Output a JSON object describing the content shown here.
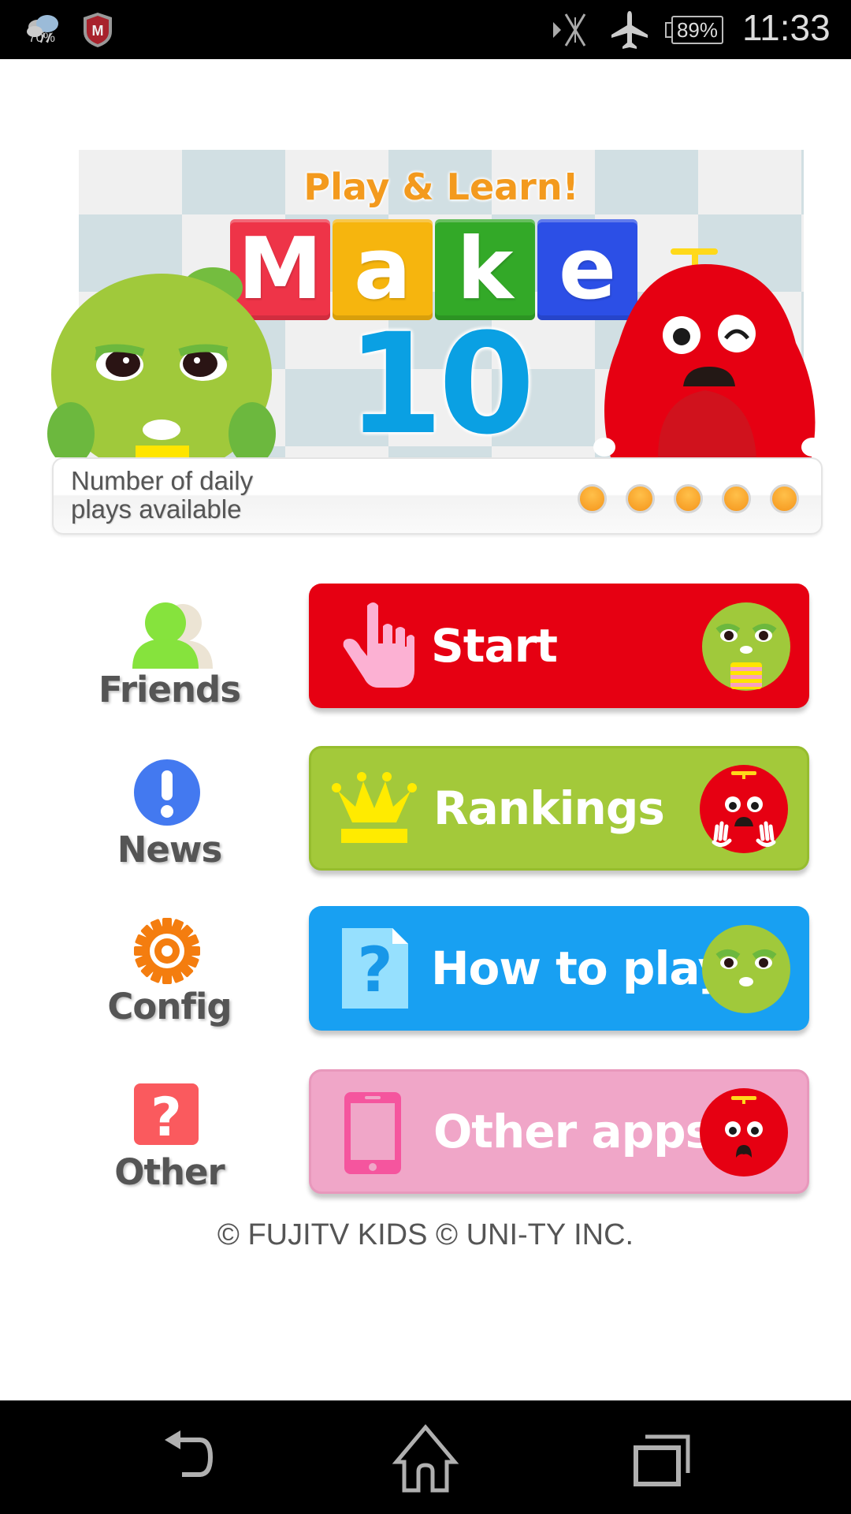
{
  "status_bar": {
    "weather_percent": "70%",
    "battery": "89%",
    "time": "11:33",
    "icons": [
      "weather-icon",
      "security-shield-icon",
      "sync-off-icon",
      "airplane-mode-icon",
      "battery-icon"
    ]
  },
  "banner": {
    "tagline": "Play & Learn!",
    "title_letters": [
      "M",
      "a",
      "k",
      "e"
    ],
    "title_number": "10",
    "tile_colors": [
      "#ee3448",
      "#f6b50e",
      "#33a928",
      "#2c4fe6"
    ]
  },
  "plays": {
    "label_line1": "Number of daily",
    "label_line2": "plays available",
    "available": 5,
    "total": 5
  },
  "side_menu": [
    {
      "label": "Friends",
      "icon": "friends-icon"
    },
    {
      "label": "News",
      "icon": "news-icon"
    },
    {
      "label": "Config",
      "icon": "gear-icon"
    },
    {
      "label": "Other",
      "icon": "question-box-icon"
    }
  ],
  "main_buttons": [
    {
      "label": "Start",
      "icon": "pointing-hand-icon",
      "color": "#e60012"
    },
    {
      "label": "Rankings",
      "icon": "crown-icon",
      "color": "#a3c93a"
    },
    {
      "label": "How to play",
      "icon": "help-document-icon",
      "color": "#18a0f2"
    },
    {
      "label": "Other apps",
      "icon": "smartphone-icon",
      "color": "#f0a6c8"
    }
  ],
  "copyright": "© FUJITV KIDS  © UNI-TY INC.",
  "nav_bar": {
    "buttons": [
      "back",
      "home",
      "recent-apps"
    ]
  }
}
